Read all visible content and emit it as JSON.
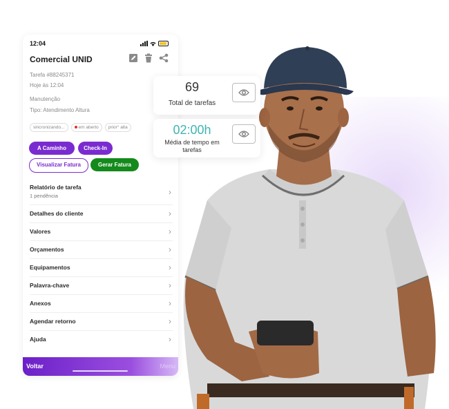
{
  "status_bar": {
    "time": "12:04"
  },
  "header": {
    "title": "Comercial UNID"
  },
  "task": {
    "number": "Tarefa #88245371",
    "date": "Hoje às 12:04",
    "category": "Manutenção",
    "type": "Tipo: Atendimento Altura",
    "chips": [
      "sincronizando...",
      "em aberto",
      "prior° alta"
    ]
  },
  "actions": {
    "a_caminho": "A Caminho",
    "check_in": "Check-In",
    "visualizar_fatura": "Visualizar Fatura",
    "gerar_fatura": "Gerar Fatura"
  },
  "menu": {
    "relatorio": {
      "label": "Relatório de tarefa",
      "sub": "1 pendência"
    },
    "items": [
      "Detalhes do cliente",
      "Valores",
      "Orçamentos",
      "Equipamentos",
      "Palavra-chave",
      "Anexos",
      "Agendar retorno",
      "Ajuda"
    ]
  },
  "bottom_bar": {
    "back": "Voltar",
    "menu": "Menu"
  },
  "cards": {
    "total": {
      "value": "69",
      "caption": "Total de tarefas"
    },
    "media": {
      "value": "02:00h",
      "caption": "Média de tempo em tarefas"
    }
  },
  "colors": {
    "primary": "#7a2bd0",
    "success": "#138a1b",
    "accent_teal": "#3fb4b2"
  }
}
